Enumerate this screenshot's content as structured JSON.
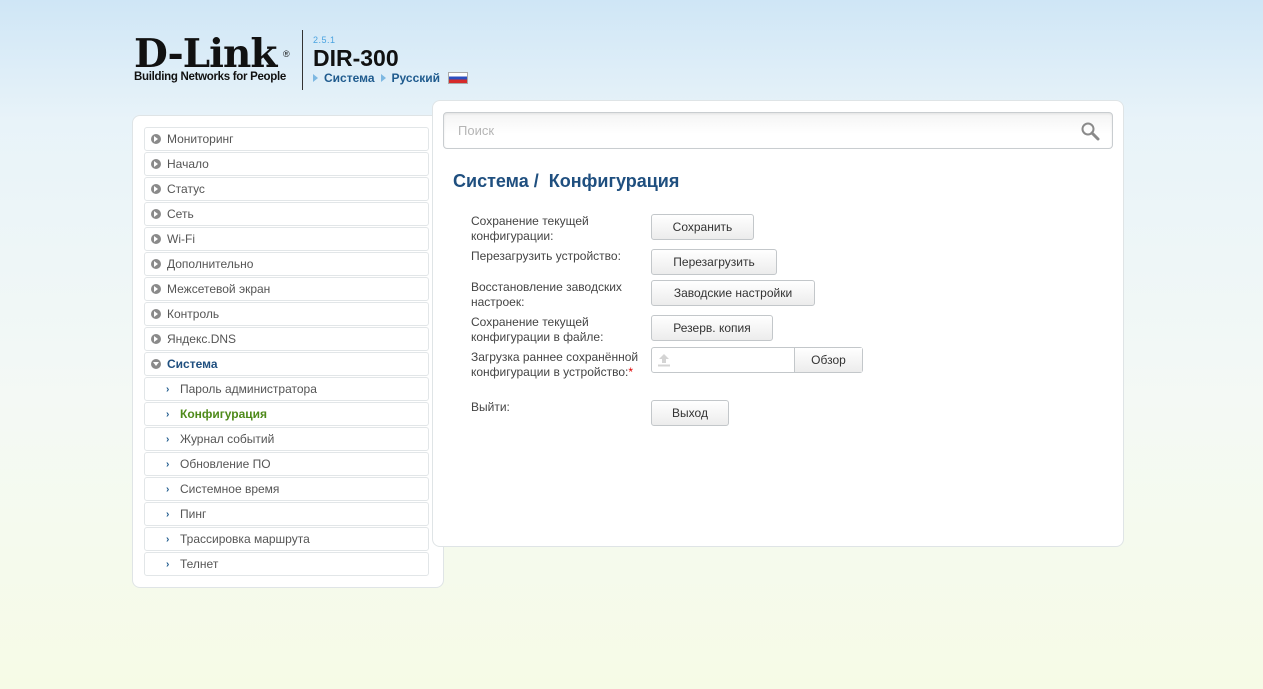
{
  "header": {
    "brand": "D-Link",
    "brand_reg": "®",
    "tagline": "Building Networks for People",
    "firmware_version": "2.5.1",
    "model": "DIR-300",
    "breadcrumb_system": "Система",
    "breadcrumb_language": "Русский",
    "flag_icon": "russia-flag-icon"
  },
  "sidebar": {
    "items": [
      {
        "label": "Мониторинг"
      },
      {
        "label": "Начало"
      },
      {
        "label": "Статус"
      },
      {
        "label": "Сеть"
      },
      {
        "label": "Wi-Fi"
      },
      {
        "label": "Дополнительно"
      },
      {
        "label": "Межсетевой экран"
      },
      {
        "label": "Контроль"
      },
      {
        "label": "Яндекс.DNS"
      },
      {
        "label": "Система"
      }
    ],
    "subitems": [
      {
        "label": "Пароль администратора"
      },
      {
        "label": "Конфигурация"
      },
      {
        "label": "Журнал событий"
      },
      {
        "label": "Обновление ПО"
      },
      {
        "label": "Системное время"
      },
      {
        "label": "Пинг"
      },
      {
        "label": "Трассировка маршрута"
      },
      {
        "label": "Телнет"
      }
    ]
  },
  "search": {
    "placeholder": "Поиск",
    "value": ""
  },
  "main": {
    "title_section": "Система /",
    "title_page": "Конфигурация",
    "rows": [
      {
        "label": "Сохранение текущей конфигурации:",
        "button": "Сохранить"
      },
      {
        "label": "Перезагрузить устройство:",
        "button": "Перезагрузить"
      },
      {
        "label": "Восстановление заводских настроек:",
        "button": "Заводские настройки"
      },
      {
        "label": "Сохранение текущей конфигурации в файле:",
        "button": "Резерв. копия"
      },
      {
        "label": "Загрузка раннее сохранённой конфигурации в устройство:",
        "required_mark": "*",
        "button": "Обзор"
      },
      {
        "label": "Выйти:",
        "button": "Выход"
      }
    ]
  },
  "colors": {
    "accent": "#1f4f7f",
    "active_submenu": "#4e8a1a",
    "required": "#dd0000"
  }
}
